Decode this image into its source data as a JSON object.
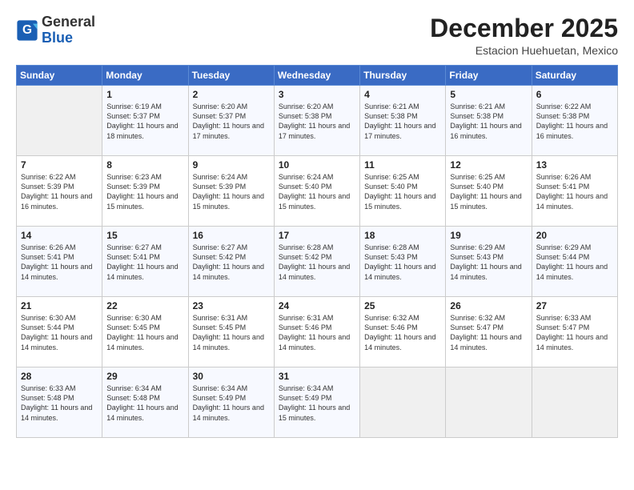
{
  "logo": {
    "text_general": "General",
    "text_blue": "Blue"
  },
  "header": {
    "month": "December 2025",
    "location": "Estacion Huehuetan, Mexico"
  },
  "weekdays": [
    "Sunday",
    "Monday",
    "Tuesday",
    "Wednesday",
    "Thursday",
    "Friday",
    "Saturday"
  ],
  "weeks": [
    [
      {
        "day": "",
        "sunrise": "",
        "sunset": "",
        "daylight": ""
      },
      {
        "day": "1",
        "sunrise": "Sunrise: 6:19 AM",
        "sunset": "Sunset: 5:37 PM",
        "daylight": "Daylight: 11 hours and 18 minutes."
      },
      {
        "day": "2",
        "sunrise": "Sunrise: 6:20 AM",
        "sunset": "Sunset: 5:37 PM",
        "daylight": "Daylight: 11 hours and 17 minutes."
      },
      {
        "day": "3",
        "sunrise": "Sunrise: 6:20 AM",
        "sunset": "Sunset: 5:38 PM",
        "daylight": "Daylight: 11 hours and 17 minutes."
      },
      {
        "day": "4",
        "sunrise": "Sunrise: 6:21 AM",
        "sunset": "Sunset: 5:38 PM",
        "daylight": "Daylight: 11 hours and 17 minutes."
      },
      {
        "day": "5",
        "sunrise": "Sunrise: 6:21 AM",
        "sunset": "Sunset: 5:38 PM",
        "daylight": "Daylight: 11 hours and 16 minutes."
      },
      {
        "day": "6",
        "sunrise": "Sunrise: 6:22 AM",
        "sunset": "Sunset: 5:38 PM",
        "daylight": "Daylight: 11 hours and 16 minutes."
      }
    ],
    [
      {
        "day": "7",
        "sunrise": "Sunrise: 6:22 AM",
        "sunset": "Sunset: 5:39 PM",
        "daylight": "Daylight: 11 hours and 16 minutes."
      },
      {
        "day": "8",
        "sunrise": "Sunrise: 6:23 AM",
        "sunset": "Sunset: 5:39 PM",
        "daylight": "Daylight: 11 hours and 15 minutes."
      },
      {
        "day": "9",
        "sunrise": "Sunrise: 6:24 AM",
        "sunset": "Sunset: 5:39 PM",
        "daylight": "Daylight: 11 hours and 15 minutes."
      },
      {
        "day": "10",
        "sunrise": "Sunrise: 6:24 AM",
        "sunset": "Sunset: 5:40 PM",
        "daylight": "Daylight: 11 hours and 15 minutes."
      },
      {
        "day": "11",
        "sunrise": "Sunrise: 6:25 AM",
        "sunset": "Sunset: 5:40 PM",
        "daylight": "Daylight: 11 hours and 15 minutes."
      },
      {
        "day": "12",
        "sunrise": "Sunrise: 6:25 AM",
        "sunset": "Sunset: 5:40 PM",
        "daylight": "Daylight: 11 hours and 15 minutes."
      },
      {
        "day": "13",
        "sunrise": "Sunrise: 6:26 AM",
        "sunset": "Sunset: 5:41 PM",
        "daylight": "Daylight: 11 hours and 14 minutes."
      }
    ],
    [
      {
        "day": "14",
        "sunrise": "Sunrise: 6:26 AM",
        "sunset": "Sunset: 5:41 PM",
        "daylight": "Daylight: 11 hours and 14 minutes."
      },
      {
        "day": "15",
        "sunrise": "Sunrise: 6:27 AM",
        "sunset": "Sunset: 5:41 PM",
        "daylight": "Daylight: 11 hours and 14 minutes."
      },
      {
        "day": "16",
        "sunrise": "Sunrise: 6:27 AM",
        "sunset": "Sunset: 5:42 PM",
        "daylight": "Daylight: 11 hours and 14 minutes."
      },
      {
        "day": "17",
        "sunrise": "Sunrise: 6:28 AM",
        "sunset": "Sunset: 5:42 PM",
        "daylight": "Daylight: 11 hours and 14 minutes."
      },
      {
        "day": "18",
        "sunrise": "Sunrise: 6:28 AM",
        "sunset": "Sunset: 5:43 PM",
        "daylight": "Daylight: 11 hours and 14 minutes."
      },
      {
        "day": "19",
        "sunrise": "Sunrise: 6:29 AM",
        "sunset": "Sunset: 5:43 PM",
        "daylight": "Daylight: 11 hours and 14 minutes."
      },
      {
        "day": "20",
        "sunrise": "Sunrise: 6:29 AM",
        "sunset": "Sunset: 5:44 PM",
        "daylight": "Daylight: 11 hours and 14 minutes."
      }
    ],
    [
      {
        "day": "21",
        "sunrise": "Sunrise: 6:30 AM",
        "sunset": "Sunset: 5:44 PM",
        "daylight": "Daylight: 11 hours and 14 minutes."
      },
      {
        "day": "22",
        "sunrise": "Sunrise: 6:30 AM",
        "sunset": "Sunset: 5:45 PM",
        "daylight": "Daylight: 11 hours and 14 minutes."
      },
      {
        "day": "23",
        "sunrise": "Sunrise: 6:31 AM",
        "sunset": "Sunset: 5:45 PM",
        "daylight": "Daylight: 11 hours and 14 minutes."
      },
      {
        "day": "24",
        "sunrise": "Sunrise: 6:31 AM",
        "sunset": "Sunset: 5:46 PM",
        "daylight": "Daylight: 11 hours and 14 minutes."
      },
      {
        "day": "25",
        "sunrise": "Sunrise: 6:32 AM",
        "sunset": "Sunset: 5:46 PM",
        "daylight": "Daylight: 11 hours and 14 minutes."
      },
      {
        "day": "26",
        "sunrise": "Sunrise: 6:32 AM",
        "sunset": "Sunset: 5:47 PM",
        "daylight": "Daylight: 11 hours and 14 minutes."
      },
      {
        "day": "27",
        "sunrise": "Sunrise: 6:33 AM",
        "sunset": "Sunset: 5:47 PM",
        "daylight": "Daylight: 11 hours and 14 minutes."
      }
    ],
    [
      {
        "day": "28",
        "sunrise": "Sunrise: 6:33 AM",
        "sunset": "Sunset: 5:48 PM",
        "daylight": "Daylight: 11 hours and 14 minutes."
      },
      {
        "day": "29",
        "sunrise": "Sunrise: 6:34 AM",
        "sunset": "Sunset: 5:48 PM",
        "daylight": "Daylight: 11 hours and 14 minutes."
      },
      {
        "day": "30",
        "sunrise": "Sunrise: 6:34 AM",
        "sunset": "Sunset: 5:49 PM",
        "daylight": "Daylight: 11 hours and 14 minutes."
      },
      {
        "day": "31",
        "sunrise": "Sunrise: 6:34 AM",
        "sunset": "Sunset: 5:49 PM",
        "daylight": "Daylight: 11 hours and 15 minutes."
      },
      {
        "day": "",
        "sunrise": "",
        "sunset": "",
        "daylight": ""
      },
      {
        "day": "",
        "sunrise": "",
        "sunset": "",
        "daylight": ""
      },
      {
        "day": "",
        "sunrise": "",
        "sunset": "",
        "daylight": ""
      }
    ]
  ]
}
